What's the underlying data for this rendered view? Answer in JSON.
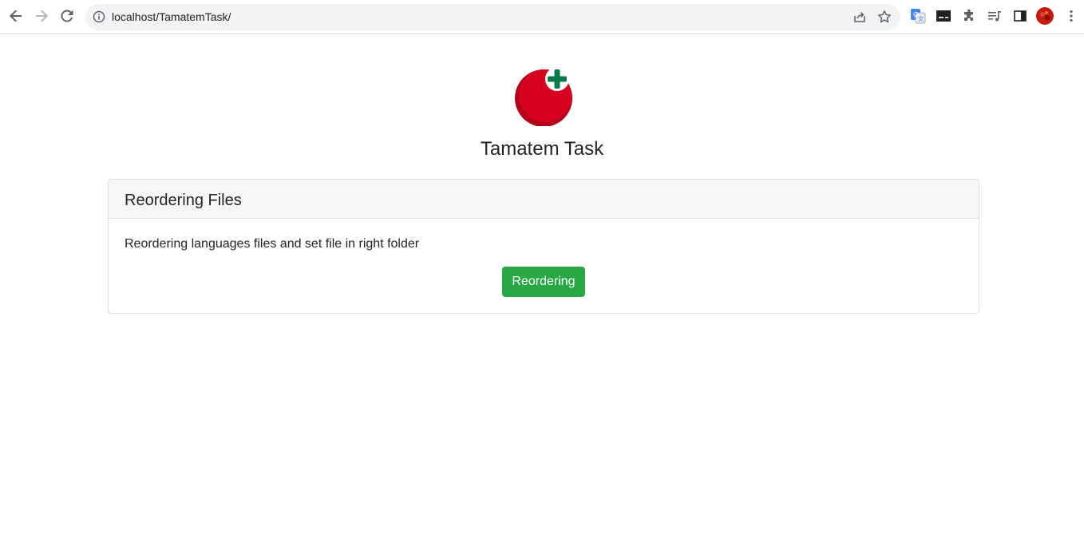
{
  "browser": {
    "url": "localhost/TamatemTask/",
    "accent": "#5f6368"
  },
  "page": {
    "title": "Tamatem Task",
    "logo_colors": {
      "tomato": "#d7001f",
      "tomato_dark": "#b3001a",
      "plus": "#0b7a4b"
    }
  },
  "card": {
    "header": "Reordering Files",
    "text": "Reordering languages files and set file in right folder",
    "button_label": "Reordering",
    "button_color": "#28a745"
  }
}
